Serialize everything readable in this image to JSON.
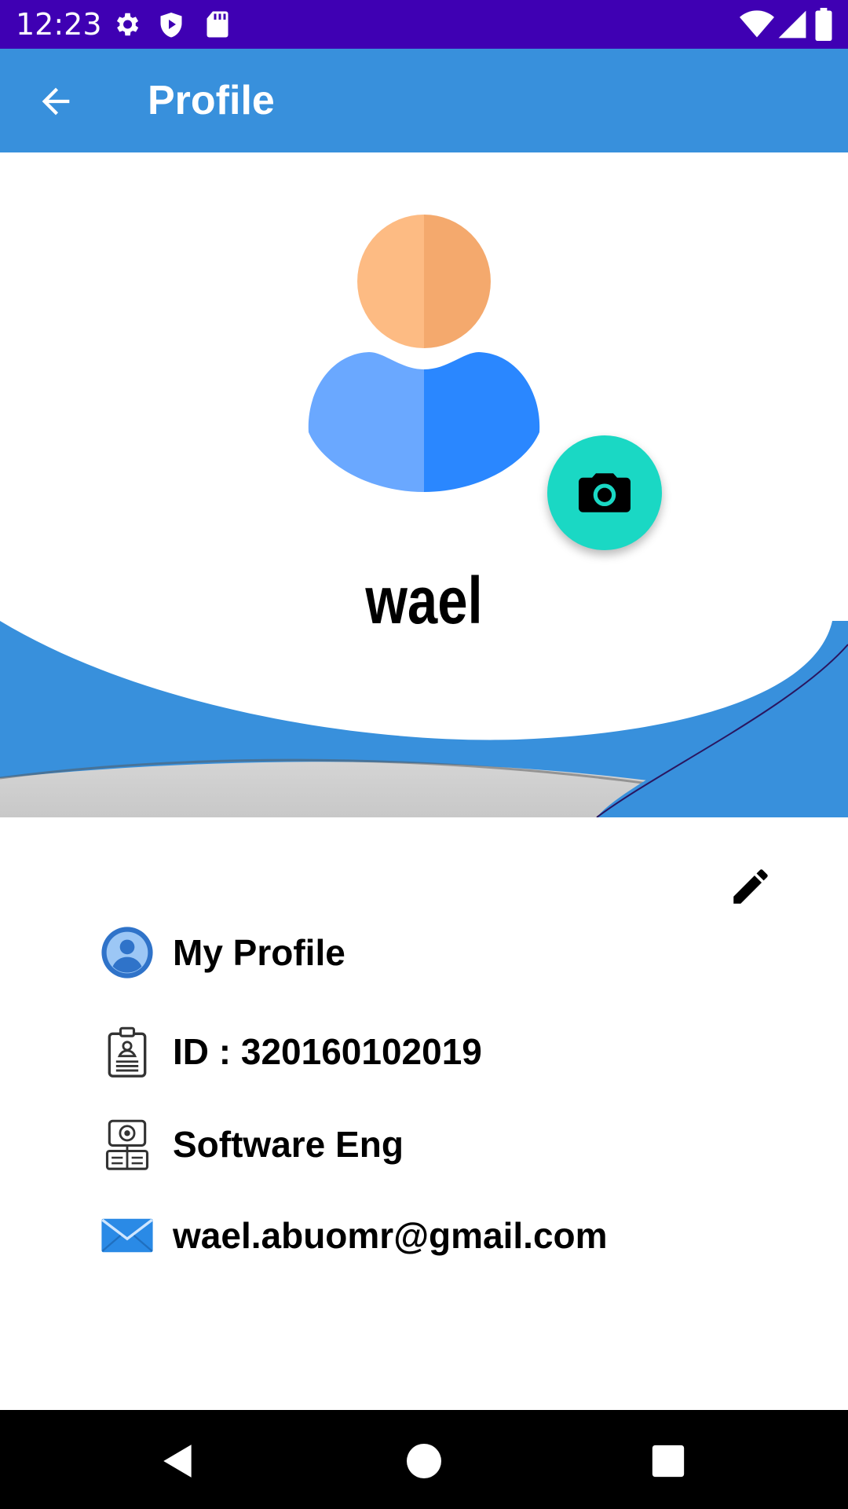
{
  "status_bar": {
    "time": "12:23",
    "background": "#3f00b3",
    "left_icons": [
      "settings-icon",
      "shield-icon",
      "sd-card-icon"
    ],
    "right_icons": [
      "wifi-icon",
      "signal-icon",
      "battery-icon"
    ]
  },
  "app_bar": {
    "title": "Profile",
    "background": "#3890dc",
    "back_icon": "arrow-back-icon"
  },
  "profile": {
    "name": "wael",
    "avatar_icon": "person-avatar-icon",
    "camera_icon": "camera-icon",
    "camera_button_color": "#1ad8c4"
  },
  "info": {
    "edit_icon": "pencil-icon",
    "rows": [
      {
        "label": "My Profile",
        "icon": "account-circle-icon"
      },
      {
        "label": "ID : 320160102019",
        "icon": "id-badge-icon"
      },
      {
        "label": "Software Eng",
        "icon": "department-icon"
      },
      {
        "label": "wael.abuomr@gmail.com",
        "icon": "email-icon"
      }
    ]
  },
  "nav_bar": {
    "buttons": [
      "back-triangle-icon",
      "home-circle-icon",
      "recents-square-icon"
    ]
  },
  "colors": {
    "accent_blue": "#3890dc",
    "avatar_skin": "#fdbb83",
    "avatar_body": "#2a87ff"
  }
}
